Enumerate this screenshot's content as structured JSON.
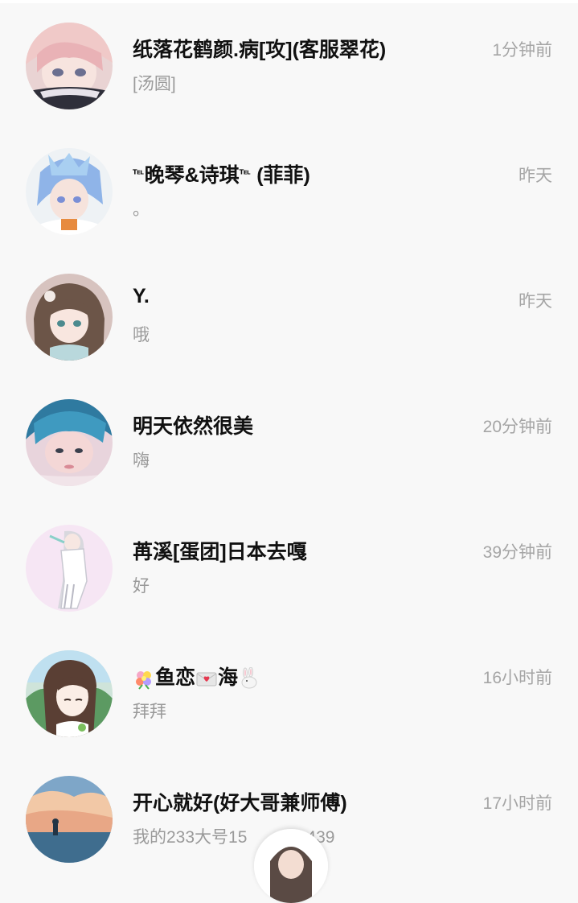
{
  "chats": [
    {
      "name": "纸落花鹤颜.病[攻](客服翠花)",
      "message": "[汤圆]",
      "time": "1分钟前",
      "avatar": "avatar-anime-pink-hair"
    },
    {
      "name_prefix": "℡",
      "name_mid": "晚琴&诗琪",
      "name_mid_tel": "℡",
      "name_suffix": " (菲菲)",
      "message": "。",
      "time": "昨天",
      "avatar": "avatar-anime-blue-hair"
    },
    {
      "name": "Y.",
      "message": "哦",
      "time": "昨天",
      "avatar": "avatar-anime-brown-hair"
    },
    {
      "name": "明天依然很美",
      "message": "嗨",
      "time": "20分钟前",
      "avatar": "avatar-blue-hair-boy"
    },
    {
      "name": "苒溪[蛋团]日本去嘎",
      "message": "好",
      "time": "39分钟前",
      "avatar": "avatar-anime-white-dress"
    },
    {
      "name_text_1": "鱼恋",
      "name_text_2": "海",
      "message": "拜拜",
      "time": "16小时前",
      "avatar": "avatar-anime-girl-green"
    },
    {
      "name": "开心就好(好大哥兼师傅)",
      "message": "我的233大号15",
      "message_tail": "439",
      "time": "17小时前",
      "avatar": "avatar-sunset-scene"
    }
  ]
}
